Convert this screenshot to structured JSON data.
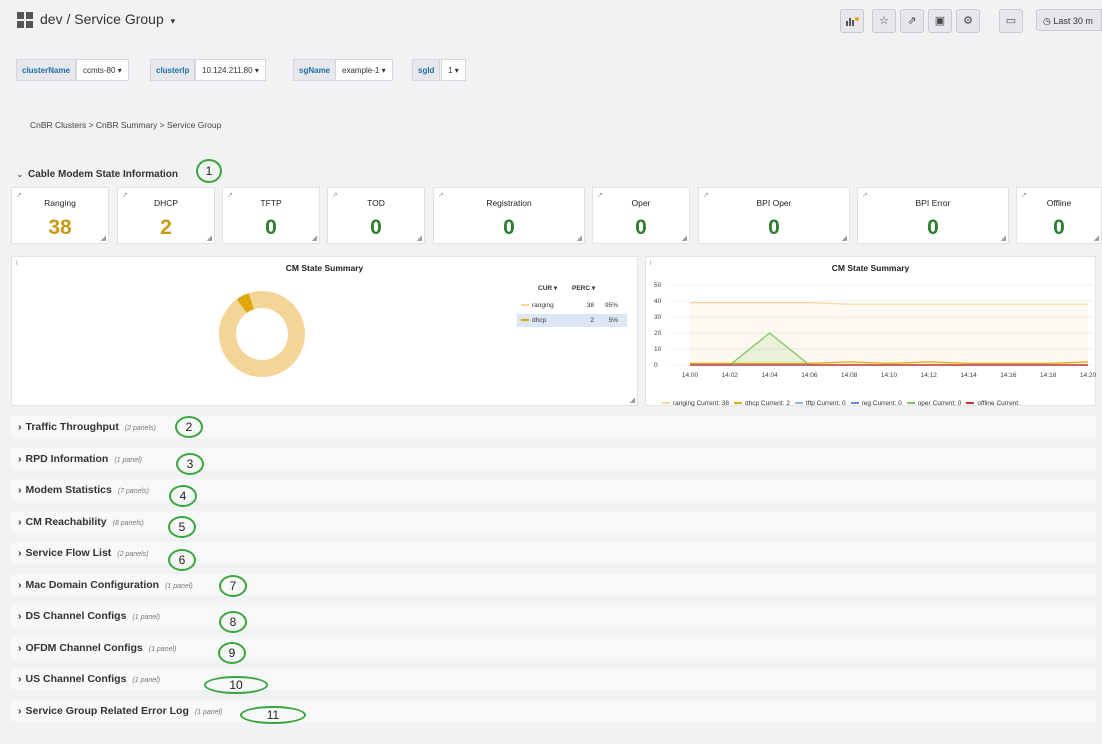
{
  "header": {
    "title": "dev / Service Group",
    "time_range": "Last 30 m"
  },
  "variables": [
    {
      "label": "clusterName",
      "value": "ccmts-80"
    },
    {
      "label": "clusterIp",
      "value": "10.124.211.80"
    },
    {
      "label": "sgName",
      "value": "example-1"
    },
    {
      "label": "sgId",
      "value": "1"
    }
  ],
  "breadcrumb": "CnBR Clusters  >  CnBR Summary  >  Service Group",
  "cm_section": {
    "title": "Cable Modem State Information",
    "callout": "1"
  },
  "stats": [
    {
      "title": "Ranging",
      "value": "38",
      "color": "#c99a12"
    },
    {
      "title": "DHCP",
      "value": "2",
      "color": "#c99a12"
    },
    {
      "title": "TFTP",
      "value": "0",
      "color": "#2e7d32"
    },
    {
      "title": "TOD",
      "value": "0",
      "color": "#2e7d32"
    },
    {
      "title": "Registration",
      "value": "0",
      "color": "#2e7d32"
    },
    {
      "title": "Oper",
      "value": "0",
      "color": "#2e7d32"
    },
    {
      "title": "BPI Oper",
      "value": "0",
      "color": "#2e7d32"
    },
    {
      "title": "BPI Error",
      "value": "0",
      "color": "#2e7d32"
    },
    {
      "title": "Offline",
      "value": "0",
      "color": "#2e7d32"
    }
  ],
  "pie_panel": {
    "title": "CM State Summary",
    "col_cur": "CUR",
    "col_perc": "PERC",
    "rows": [
      {
        "name": "ranging",
        "cur": "38",
        "perc": "95%",
        "color": "#f4d598"
      },
      {
        "name": "dhcp",
        "cur": "2",
        "perc": "5%",
        "color": "#e0a60e"
      }
    ]
  },
  "line_panel": {
    "title": "CM State Summary",
    "legend": [
      {
        "text": "ranging  Current: 38",
        "color": "#f4d598"
      },
      {
        "text": "dhcp  Current: 2",
        "color": "#e0a60e"
      },
      {
        "text": "tftp  Current: 0",
        "color": "#8ab8e6"
      },
      {
        "text": "reg  Current: 0",
        "color": "#5b8fd6"
      },
      {
        "text": "oper  Current: 0",
        "color": "#7cc45e"
      },
      {
        "text": "offline  Current:",
        "color": "#d32f2f"
      }
    ]
  },
  "chart_data": [
    {
      "type": "pie",
      "title": "CM State Summary",
      "categories": [
        "ranging",
        "dhcp"
      ],
      "values": [
        38,
        2
      ],
      "percent": [
        95,
        5
      ]
    },
    {
      "type": "line",
      "title": "CM State Summary",
      "x": [
        "14:00",
        "14:02",
        "14:04",
        "14:06",
        "14:08",
        "14:10",
        "14:12",
        "14:14",
        "14:16",
        "14:18",
        "14:20"
      ],
      "ylim": [
        0,
        50
      ],
      "yticks": [
        0,
        10,
        20,
        30,
        40,
        50
      ],
      "series": [
        {
          "name": "ranging",
          "values": [
            39,
            39,
            39,
            39,
            38,
            38,
            38,
            38,
            38,
            38,
            38
          ]
        },
        {
          "name": "dhcp",
          "values": [
            1,
            1,
            1,
            1,
            2,
            1,
            2,
            1,
            1,
            1,
            2
          ]
        },
        {
          "name": "tftp",
          "values": [
            0,
            0,
            0,
            0,
            0,
            0,
            0,
            0,
            0,
            0,
            0
          ]
        },
        {
          "name": "reg",
          "values": [
            0,
            0,
            0,
            0,
            0,
            0,
            0,
            0,
            0,
            0,
            0
          ]
        },
        {
          "name": "oper",
          "values": [
            0,
            0,
            20,
            0,
            0,
            0,
            0,
            0,
            0,
            0,
            0
          ]
        },
        {
          "name": "offline",
          "values": [
            0,
            0,
            0,
            0,
            0,
            0,
            0,
            0,
            0,
            0,
            0
          ]
        }
      ]
    }
  ],
  "rows": [
    {
      "title": "Traffic Throughput",
      "count": "(2 panels)",
      "callout": "2"
    },
    {
      "title": "RPD Information",
      "count": "(1 panel)",
      "callout": "3"
    },
    {
      "title": "Modem Statistics",
      "count": "(7 panels)",
      "callout": "4"
    },
    {
      "title": "CM Reachability",
      "count": "(8 panels)",
      "callout": "5"
    },
    {
      "title": "Service Flow List",
      "count": "(2 panels)",
      "callout": "6"
    },
    {
      "title": "Mac Domain Configuration",
      "count": "(1 panel)",
      "callout": "7"
    },
    {
      "title": "DS Channel Configs",
      "count": "(1 panel)",
      "callout": "8"
    },
    {
      "title": "OFDM Channel Configs",
      "count": "(1 panel)",
      "callout": "9"
    },
    {
      "title": "US Channel Configs",
      "count": "(1 panel)",
      "callout": "10"
    },
    {
      "title": "Service Group Related Error Log",
      "count": "(1 panel)",
      "callout": "11"
    }
  ]
}
